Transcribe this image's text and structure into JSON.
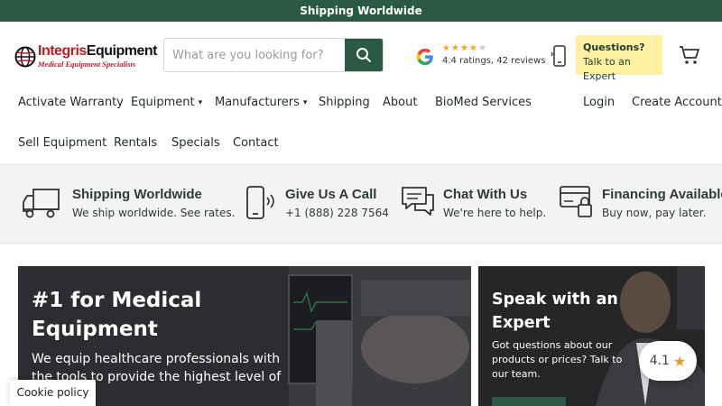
{
  "announcement": "Shipping Worldwide",
  "logo": {
    "brand_left": "Integris",
    "brand_right": "Equipment",
    "tagline": "Medical Equipment Specialists"
  },
  "search": {
    "placeholder": "What are you looking for?"
  },
  "rating": {
    "stars_filled": "★★★★",
    "stars_empty": "★",
    "text": "4.4 ratings, 42 reviews"
  },
  "expert": {
    "title": "Questions?",
    "subtitle": "Talk to an Expert"
  },
  "nav": {
    "activate_warranty": "Activate Warranty",
    "equipment": "Equipment",
    "manufacturers": "Manufacturers",
    "shipping": "Shipping",
    "about": "About",
    "biomed": "BioMed Services",
    "login": "Login",
    "create_account": "Create Account",
    "sell_equipment": "Sell Equipment",
    "rentals": "Rentals",
    "specials": "Specials",
    "contact": "Contact"
  },
  "features": [
    {
      "title": "Shipping Worldwide",
      "subtitle": "We ship worldwide. See rates.",
      "icon": "truck-icon"
    },
    {
      "title": "Give Us A Call",
      "subtitle": "+1 (888) 228 7564",
      "icon": "phone-icon"
    },
    {
      "title": "Chat With Us",
      "subtitle": "We're here to help.",
      "icon": "chat-icon"
    },
    {
      "title": "Financing Available",
      "subtitle": "Buy now, pay later.",
      "icon": "credit-card-lock-icon"
    }
  ],
  "hero": {
    "title": "#1 for Medical Equipment",
    "text": "We equip healthcare professionals with the tools to provide the highest level of patient"
  },
  "side": {
    "title": "Speak with an Expert",
    "text": "Got questions about our products or prices? Talk to our team."
  },
  "badge": {
    "score": "4.1",
    "star": "★"
  },
  "cookie": "Cookie policy",
  "colors": {
    "brand_green": "#2b5a44",
    "expert_yellow": "#fdf0a2",
    "logo_red": "#b81d24",
    "star_orange": "#f2a31b"
  }
}
